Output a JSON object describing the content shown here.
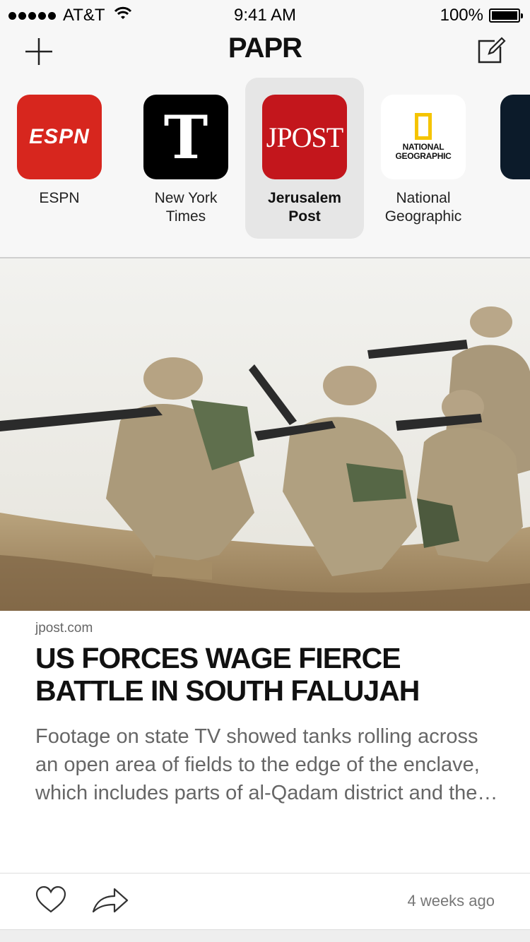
{
  "status_bar": {
    "carrier": "AT&T",
    "time": "9:41 AM",
    "battery_percent": "100%",
    "battery_level": 1.0
  },
  "nav": {
    "title": "PAPR",
    "left_icon": "plus-icon",
    "right_icon": "compose-icon"
  },
  "sources": [
    {
      "name": "ESPN",
      "logo_text": "ESPN",
      "brand_color": "#d7261e",
      "selected": false
    },
    {
      "name": "New York Times",
      "logo_text": "T",
      "brand_color": "#000000",
      "selected": false
    },
    {
      "name": "Jerusalem Post",
      "logo_text": "JPOST",
      "brand_color": "#c3161c",
      "selected": true
    },
    {
      "name": "National Geographic",
      "logo_text": "NATIONAL GEOGRAPHIC",
      "brand_color": "#f5c400",
      "selected": false
    }
  ],
  "article": {
    "source": "jpost.com",
    "title": "US FORCES WAGE FIERCE BATTLE IN SOUTH FALUJAH",
    "excerpt": "Footage on state TV showed tanks rolling across an open area of fields to the edge of the enclave, which includes parts of al-Qadam district and the…",
    "time_ago": "4 weeks ago"
  }
}
